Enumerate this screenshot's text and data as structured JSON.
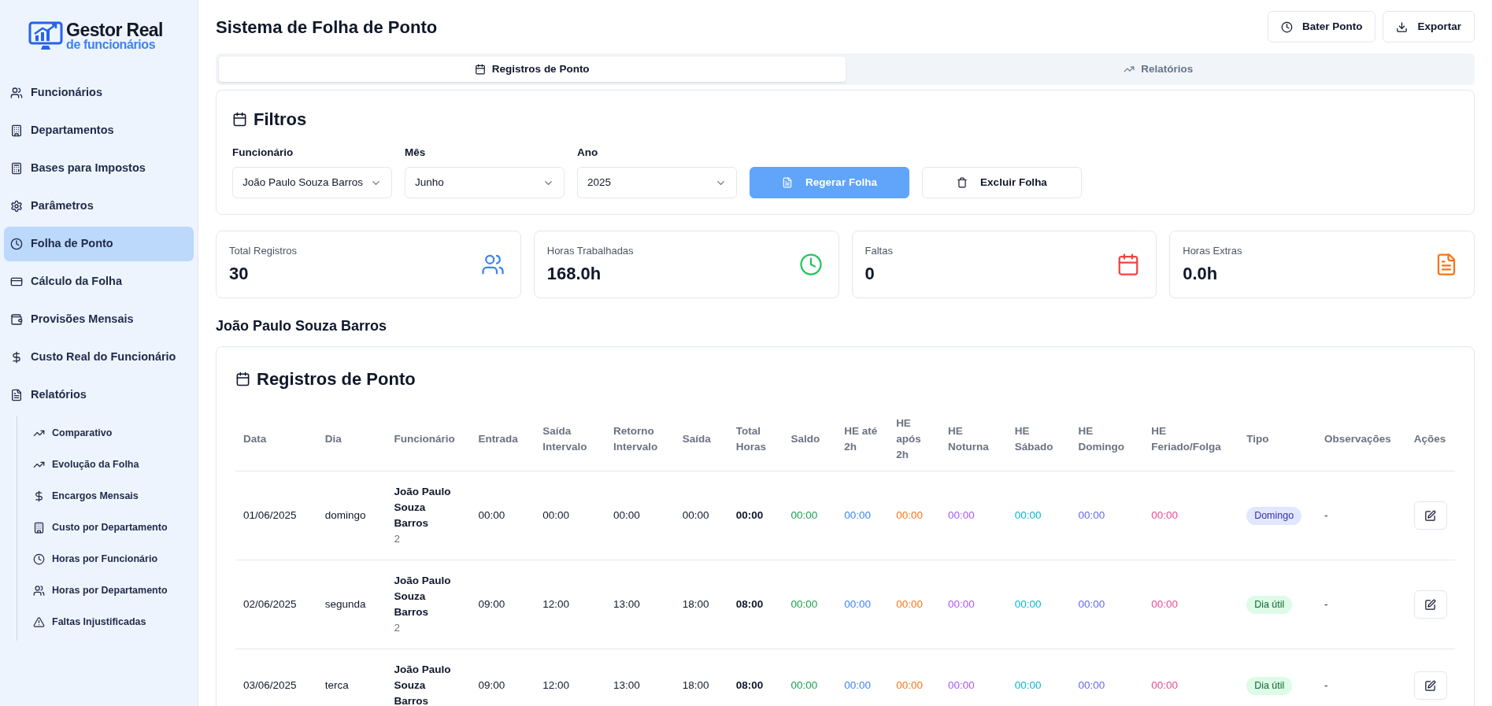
{
  "logo": {
    "title": "Gestor Real",
    "subtitle": "de funcionários"
  },
  "sidebar": {
    "items": [
      {
        "label": "Funcionários",
        "selected": false
      },
      {
        "label": "Departamentos",
        "selected": false
      },
      {
        "label": "Bases para Impostos",
        "selected": false
      },
      {
        "label": "Parâmetros",
        "selected": false
      },
      {
        "label": "Folha de Ponto",
        "selected": true
      },
      {
        "label": "Cálculo da Folha",
        "selected": false
      },
      {
        "label": "Provisões Mensais",
        "selected": false
      },
      {
        "label": "Custo Real do Funcionário",
        "selected": false
      },
      {
        "label": "Relatórios",
        "selected": false,
        "expanded": true,
        "children": [
          {
            "label": "Comparativo"
          },
          {
            "label": "Evolução da Folha"
          },
          {
            "label": "Encargos Mensais"
          },
          {
            "label": "Custo por Departamento"
          },
          {
            "label": "Horas por Funcionário"
          },
          {
            "label": "Horas por Departamento"
          },
          {
            "label": "Faltas Injustificadas"
          }
        ]
      }
    ]
  },
  "header": {
    "title": "Sistema de Folha de Ponto",
    "buttons": [
      "Bater Ponto",
      "Exportar"
    ]
  },
  "tabs": [
    {
      "label": "Registros de Ponto",
      "selected": true
    },
    {
      "label": "Relatórios",
      "selected": false
    }
  ],
  "filters": {
    "title": "Filtros",
    "fields": [
      {
        "label": "Funcionário",
        "value": "João Paulo Souza Barros"
      },
      {
        "label": "Mês",
        "value": "Junho"
      },
      {
        "label": "Ano",
        "value": "2025"
      }
    ],
    "buttons": [
      {
        "label": "Regerar Folha",
        "kind": "primary"
      },
      {
        "label": "Excluir Folha",
        "kind": "outline"
      }
    ]
  },
  "stats": [
    {
      "label": "Total Registros",
      "value": "30"
    },
    {
      "label": "Horas Trabalhadas",
      "value": "168.0h"
    },
    {
      "label": "Faltas",
      "value": "0"
    },
    {
      "label": "Horas Extras",
      "value": "0.0h"
    }
  ],
  "employee_heading": "João Paulo Souza Barros",
  "table": {
    "title": "Registros de Ponto",
    "columns": [
      "Data",
      "Dia",
      "Funcionário",
      "Entrada",
      "Saída Intervalo",
      "Retorno Intervalo",
      "Saída",
      "Total Horas",
      "Saldo",
      "HE até 2h",
      "HE após 2h",
      "HE Noturna",
      "HE Sábado",
      "HE Domingo",
      "HE Feriado/Folga",
      "Tipo",
      "Observações",
      "Ações"
    ],
    "rows": [
      {
        "cells": [
          "01/06/2025",
          "domingo"
        ],
        "employee": "João Paulo Souza Barros",
        "employee_id": "2",
        "times": [
          "00:00",
          "00:00",
          "00:00",
          "00:00",
          "00:00",
          "00:00",
          "00:00",
          "00:00",
          "00:00",
          "00:00",
          "00:00",
          "00:00"
        ],
        "tipo": {
          "label": "Domingo",
          "kind": "domingo"
        },
        "observacoes": "-"
      },
      {
        "cells": [
          "02/06/2025",
          "segunda"
        ],
        "employee": "João Paulo Souza Barros",
        "employee_id": "2",
        "times": [
          "09:00",
          "12:00",
          "13:00",
          "18:00",
          "08:00",
          "00:00",
          "00:00",
          "00:00",
          "00:00",
          "00:00",
          "00:00",
          "00:00"
        ],
        "tipo": {
          "label": "Dia útil",
          "kind": "dia_util"
        },
        "observacoes": "-"
      },
      {
        "cells": [
          "03/06/2025",
          "terca"
        ],
        "employee": "João Paulo Souza Barros",
        "times": [
          "09:00",
          "12:00",
          "13:00",
          "18:00",
          "08:00",
          "00:00",
          "00:00",
          "00:00",
          "00:00",
          "00:00",
          "00:00",
          "00:00"
        ],
        "tipo": {
          "label": "Dia útil",
          "kind": "dia_util"
        },
        "observacoes": "-"
      }
    ]
  }
}
